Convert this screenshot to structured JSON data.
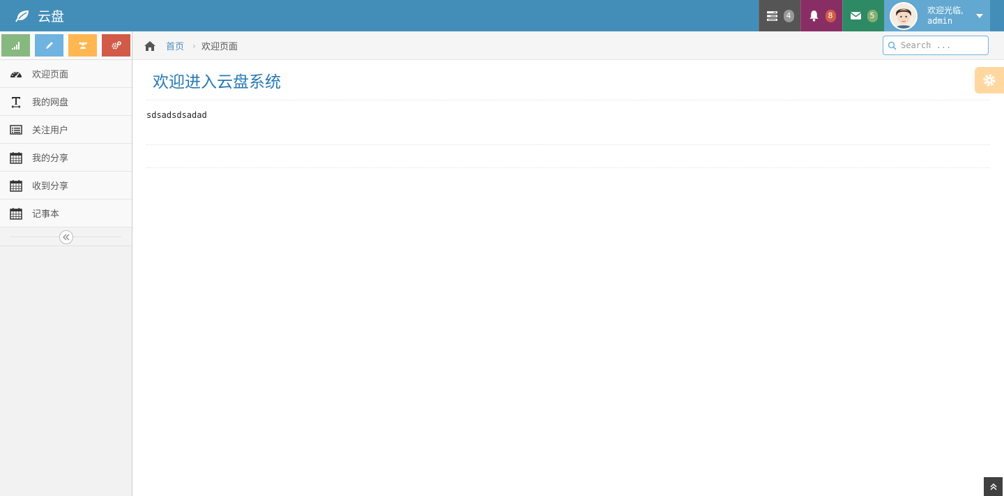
{
  "navbar": {
    "brand_title": "云盘",
    "brand_icon": "leaf-icon",
    "tasks_badge": "4",
    "notifications_badge": "8",
    "messages_badge": "5",
    "user_welcome": "欢迎光临,",
    "user_name": "admin"
  },
  "shortcuts": [
    {
      "icon": "signal-icon",
      "color": "#87b87f"
    },
    {
      "icon": "pencil-icon",
      "color": "#6fb3e0"
    },
    {
      "icon": "group-icon",
      "color": "#ffb752"
    },
    {
      "icon": "cogs-icon",
      "color": "#d15b47"
    }
  ],
  "sidebar": {
    "items": [
      {
        "label": "欢迎页面",
        "icon": "dashboard-icon"
      },
      {
        "label": "我的网盘",
        "icon": "text-width-icon"
      },
      {
        "label": "关注用户",
        "icon": "list-alt-icon"
      },
      {
        "label": "我的分享",
        "icon": "calendar-icon"
      },
      {
        "label": "收到分享",
        "icon": "calendar-icon"
      },
      {
        "label": "记事本",
        "icon": "calendar-icon"
      }
    ]
  },
  "breadcrumb": {
    "home_label": "首页",
    "current_label": "欢迎页面"
  },
  "search": {
    "placeholder": "Search ..."
  },
  "page": {
    "title": "欢迎进入云盘系统",
    "content": "sdsadsdsadad"
  },
  "colors": {
    "navbar": "#438eb9",
    "accent": "#2679b5",
    "link": "#4c8fbd"
  }
}
